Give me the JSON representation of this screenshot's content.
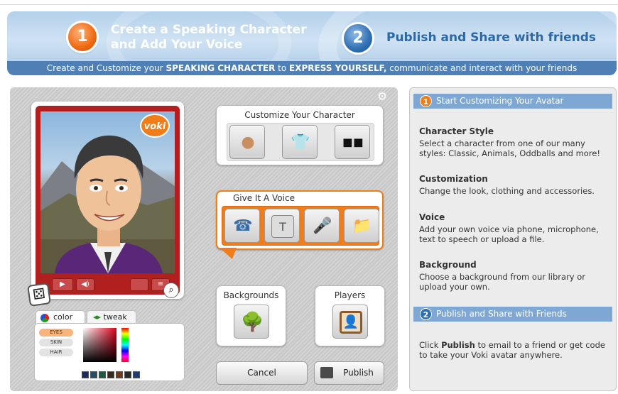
{
  "banner": {
    "step1_number": "1",
    "step1_line1": "Create a Speaking Character",
    "step1_line2": "and Add Your Voice",
    "step2_number": "2",
    "step2_title": "Publish and Share with friends",
    "tagline_pre": "Create and Customize your",
    "tagline_b1": "SPEAKING CHARACTER",
    "tagline_mid": "to",
    "tagline_b2": "EXPRESS YOURSELF,",
    "tagline_post": "communicate and interact with your friends"
  },
  "player": {
    "logo_text": "voki"
  },
  "customize": {
    "title": "Customize Your Character",
    "icons": [
      "person-icon",
      "clothing-icon",
      "sunglasses-icon"
    ]
  },
  "voice": {
    "title": "Give It A Voice",
    "icons": [
      "phone-icon",
      "keyboard-icon",
      "microphone-icon",
      "folder-upload-icon"
    ]
  },
  "backgrounds": {
    "title": "Backgrounds"
  },
  "players": {
    "title": "Players"
  },
  "buttons": {
    "cancel": "Cancel",
    "publish": "Publish"
  },
  "color_panel": {
    "tab_color": "color",
    "tab_tweak": "tweak",
    "options": [
      "EYES",
      "SKIN",
      "HAIR"
    ],
    "selected": "EYES",
    "swatch_colors": [
      "#1a2a5a",
      "#2a4a6a",
      "#1a5a3a",
      "#3a2a1a",
      "#6a3a1a",
      "#2a2a2a",
      "#1a3a7a"
    ]
  },
  "info": {
    "step1_number": "1",
    "step1_header": "Start Customizing Your Avatar",
    "sections": [
      {
        "title": "Character Style",
        "text": "Select a character from one of our many styles: Classic, Animals, Oddballs and more!"
      },
      {
        "title": "Customization",
        "text": "Change the look, clothing and accessories."
      },
      {
        "title": "Voice",
        "text": "Add your own voice via phone, microphone, text to speech or upload a file."
      },
      {
        "title": "Background",
        "text": "Choose a background from our library or upload your own."
      }
    ],
    "step2_number": "2",
    "step2_header": "Publish and Share with Friends",
    "publish_pre": "Click",
    "publish_bold": "Publish",
    "publish_post": "to email to a friend or get code to take your Voki avatar anywhere."
  },
  "colors": {
    "accent_orange": "#f07d1a",
    "accent_blue": "#2f6fb3",
    "frame_red": "#b21f1f",
    "header_blue": "#7ea8d3"
  }
}
